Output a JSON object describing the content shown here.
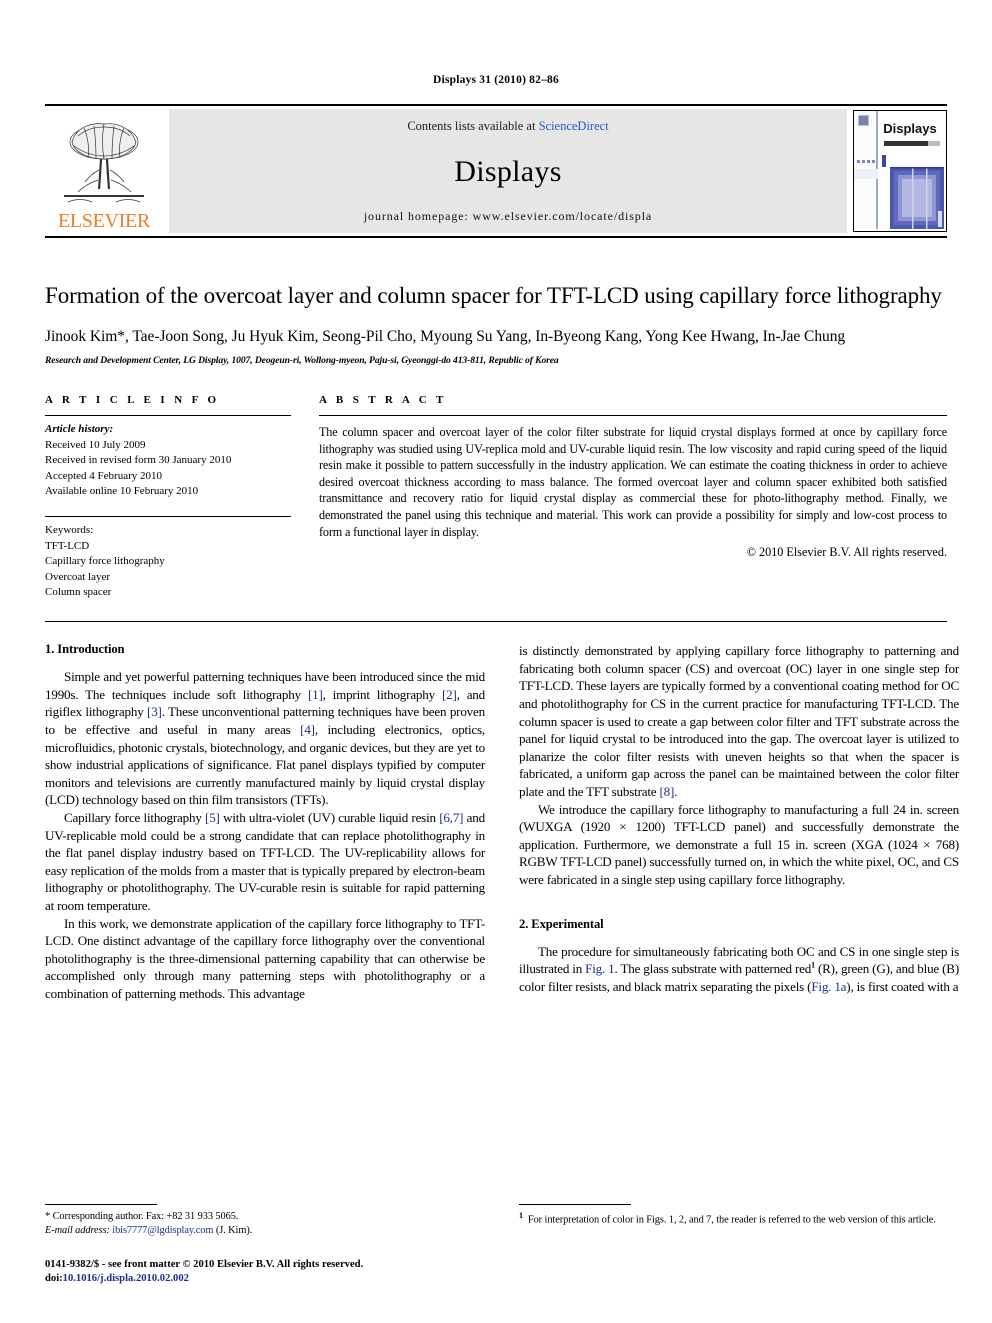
{
  "running_head": "Displays 31 (2010) 82–86",
  "masthead": {
    "publisher_logo_text": "ELSEVIER",
    "contents_prefix": "Contents lists available at ",
    "contents_link": "ScienceDirect",
    "journal_name": "Displays",
    "homepage_line": "journal homepage: www.elsevier.com/locate/displa",
    "cover_title": "Displays"
  },
  "article": {
    "title": "Formation of the overcoat layer and column spacer for TFT-LCD using capillary force lithography",
    "authors": "Jinook Kim*, Tae-Joon Song, Ju Hyuk Kim, Seong-Pil Cho, Myoung Su Yang, In-Byeong Kang, Yong Kee Hwang, In-Jae Chung",
    "affiliation": "Research and Development Center, LG Display, 1007, Deogeun-ri, Wollong-myeon, Paju-si, Gyeonggi-do 413-811, Republic of Korea"
  },
  "article_info": {
    "heading": "A R T I C L E   I N F O",
    "history_label": "Article history:",
    "history": [
      "Received 10 July 2009",
      "Received in revised form 30 January 2010",
      "Accepted 4 February 2010",
      "Available online 10 February 2010"
    ],
    "keywords_label": "Keywords:",
    "keywords": [
      "TFT-LCD",
      "Capillary force lithography",
      "Overcoat layer",
      "Column spacer"
    ]
  },
  "abstract": {
    "heading": "A B S T R A C T",
    "text": "The column spacer and overcoat layer of the color filter substrate for liquid crystal displays formed at once by capillary force lithography was studied using UV-replica mold and UV-curable liquid resin. The low viscosity and rapid curing speed of the liquid resin make it possible to pattern successfully in the industry application. We can estimate the coating thickness in order to achieve desired overcoat thickness according to mass balance. The formed overcoat layer and column spacer exhibited both satisfied transmittance and recovery ratio for liquid crystal display as commercial these for photo-lithography method. Finally, we demonstrated the panel using this technique and material. This work can provide a possibility for simply and low-cost process to form a functional layer in display.",
    "copyright": "© 2010 Elsevier B.V. All rights reserved."
  },
  "body": {
    "intro_heading": "1. Introduction",
    "intro_p1_a": "Simple and yet powerful patterning techniques have been introduced since the mid 1990s. The techniques include soft lithography ",
    "intro_p1_ref1": "[1]",
    "intro_p1_b": ", imprint lithography ",
    "intro_p1_ref2": "[2]",
    "intro_p1_c": ", and rigiflex lithography ",
    "intro_p1_ref3": "[3]",
    "intro_p1_d": ". These unconventional patterning techniques have been proven to be effective and useful in many areas ",
    "intro_p1_ref4": "[4]",
    "intro_p1_e": ", including electronics, optics, microfluidics, photonic crystals, biotechnology, and organic devices, but they are yet to show industrial applications of significance. Flat panel displays typified by computer monitors and televisions are currently manufactured mainly by liquid crystal display (LCD) technology based on thin film transistors (TFTs).",
    "intro_p2_a": "Capillary force lithography ",
    "intro_p2_ref5": "[5]",
    "intro_p2_b": " with ultra-violet (UV) curable liquid resin ",
    "intro_p2_ref67": "[6,7]",
    "intro_p2_c": " and UV-replicable mold could be a strong candidate that can replace photolithography in the flat panel display industry based on TFT-LCD. The UV-replicability allows for easy replication of the molds from a master that is typically prepared by electron-beam lithography or photolithography. The UV-curable resin is suitable for rapid patterning at room temperature.",
    "intro_p3": "In this work, we demonstrate application of the capillary force lithography to TFT-LCD. One distinct advantage of the capillary force lithography over the conventional photolithography is the three-dimensional patterning capability that can otherwise be accomplished only through many patterning steps with photolithography or a combination of patterning methods. This advantage",
    "intro_p3_cont_a": "is distinctly demonstrated by applying capillary force lithography to patterning and fabricating both column spacer (CS) and overcoat (OC) layer in one single step for TFT-LCD. These layers are typically formed by a conventional coating method for OC and photolithography for CS in the current practice for manufacturing TFT-LCD. The column spacer is used to create a gap between color filter and TFT substrate across the panel for liquid crystal to be introduced into the gap. The overcoat layer is utilized to planarize the color filter resists with uneven heights so that when the spacer is fabricated, a uniform gap across the panel can be maintained between the color filter plate and the TFT substrate ",
    "intro_p3_ref8": "[8]",
    "intro_p3_cont_b": ".",
    "intro_p4": "We introduce the capillary force lithography to manufacturing a full 24 in. screen (WUXGA (1920 × 1200) TFT-LCD panel) and successfully demonstrate the application. Furthermore, we demonstrate a full 15 in. screen (XGA (1024 × 768) RGBW TFT-LCD panel) successfully turned on, in which the white pixel, OC, and CS were fabricated in a single step using capillary force lithography.",
    "exp_heading": "2. Experimental",
    "exp_p1_a": "The procedure for simultaneously fabricating both OC and CS in one single step is illustrated in ",
    "exp_p1_fig1": "Fig. 1",
    "exp_p1_b": ". The glass substrate with patterned red",
    "exp_p1_fnmark": "1",
    "exp_p1_c": " (R), green (G), and blue (B) color filter resists, and black matrix separating the pixels (",
    "exp_p1_fig1a": "Fig. 1a",
    "exp_p1_d": "), is first coated with a"
  },
  "footnotes": {
    "corresponding": "* Corresponding author. Fax: +82 31 933 5065.",
    "email_label": "E-mail address:",
    "email": "ibis7777@lgdisplay.com",
    "email_suffix": "(J. Kim).",
    "issn_line": "0141-9382/$ - see front matter © 2010 Elsevier B.V. All rights reserved.",
    "doi_label": "doi:",
    "doi": "10.1016/j.displa.2010.02.002",
    "right_mark": "1",
    "right_text": "For interpretation of color in Figs. 1, 2, and 7, the reader is referred to the web version of this article."
  },
  "colors": {
    "link_blue": "#2a56c6",
    "ref_blue": "#1c2f8f",
    "elsevier_orange": "#F47B20",
    "band_gray": "#e6e6e6"
  }
}
